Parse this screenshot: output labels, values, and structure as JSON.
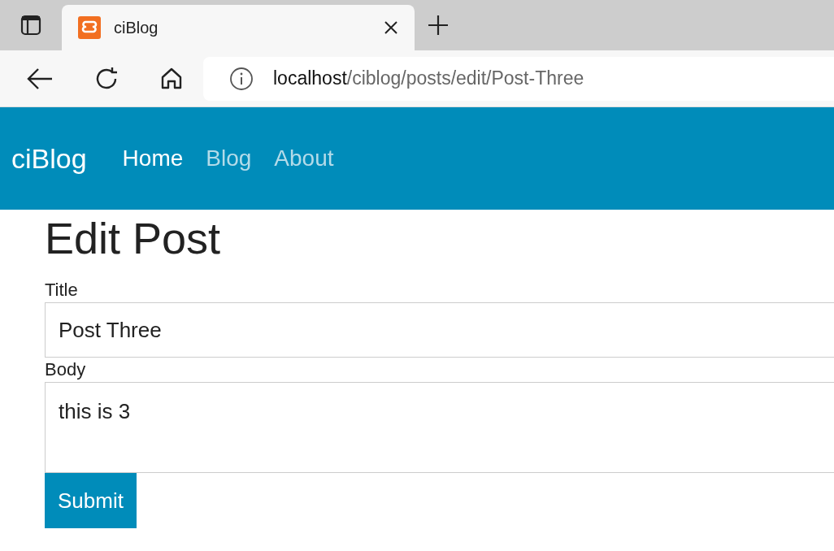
{
  "browser": {
    "tab": {
      "title": "ciBlog"
    },
    "address": {
      "host": "localhost",
      "path": "/ciblog/posts/edit/Post-Three"
    }
  },
  "navbar": {
    "brand": "ciBlog",
    "links": [
      {
        "label": "Home",
        "selected": true
      },
      {
        "label": "Blog",
        "selected": false
      },
      {
        "label": "About",
        "selected": false
      }
    ]
  },
  "heading": "Edit Post",
  "form": {
    "fields": [
      {
        "kind": "input",
        "label": "Title",
        "value": "Post Three"
      },
      {
        "kind": "textarea",
        "label": "Body",
        "value": "this is 3"
      }
    ],
    "submit": "Submit"
  }
}
